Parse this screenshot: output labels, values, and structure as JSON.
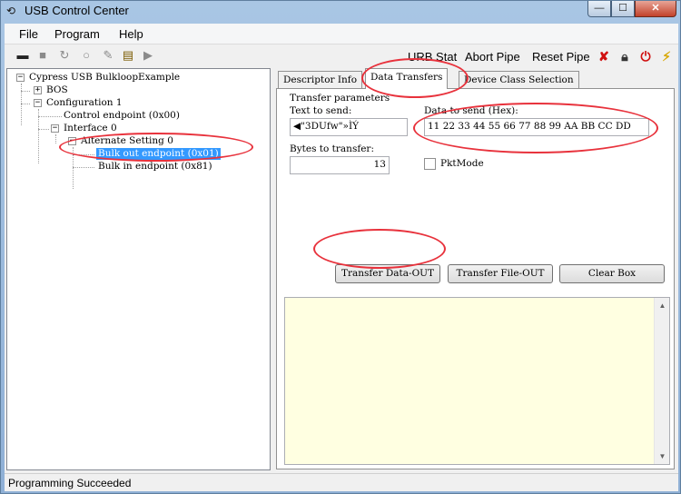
{
  "window": {
    "title": "USB Control Center",
    "min_glyph": "—",
    "max_glyph": "☐",
    "close_glyph": "✕"
  },
  "menu": [
    "File",
    "Program",
    "Help"
  ],
  "toolbar": {
    "urb_stat": "URB Stat",
    "abort_pipe": "Abort Pipe",
    "reset_pipe": "Reset Pipe"
  },
  "tree": {
    "device": "Cypress USB BulkloopExample",
    "bos": "BOS",
    "configuration": "Configuration 1",
    "control_endpoint": "Control endpoint (0x00)",
    "interface": "Interface 0",
    "alternate_setting": "Alternate Setting 0",
    "bulk_out": "Bulk out endpoint (0x01)",
    "bulk_in": "Bulk in endpoint (0x81)"
  },
  "tabs": [
    "Descriptor Info",
    "Data Transfers",
    "Device Class Selection"
  ],
  "transfer": {
    "group_label": "Transfer parameters",
    "text_to_send_label": "Text to send:",
    "text_to_send_value": "◀\"3DUfw\"»ÌÝ",
    "data_to_send_label": "Data to send (Hex):",
    "data_to_send_value": "11 22 33 44 55 66 77 88 99 AA BB CC DD",
    "bytes_label": "Bytes to transfer:",
    "bytes_value": "13",
    "pktmode_label": "PktMode",
    "pktmode_checked": false,
    "btn_transfer_data": "Transfer Data-OUT",
    "btn_transfer_file": "Transfer File-OUT",
    "btn_clear": "Clear Box"
  },
  "status": "Programming Succeeded",
  "colors": {
    "annotation": "#e8323c",
    "selection": "#3399ff",
    "output_bg": "#ffffe1"
  }
}
